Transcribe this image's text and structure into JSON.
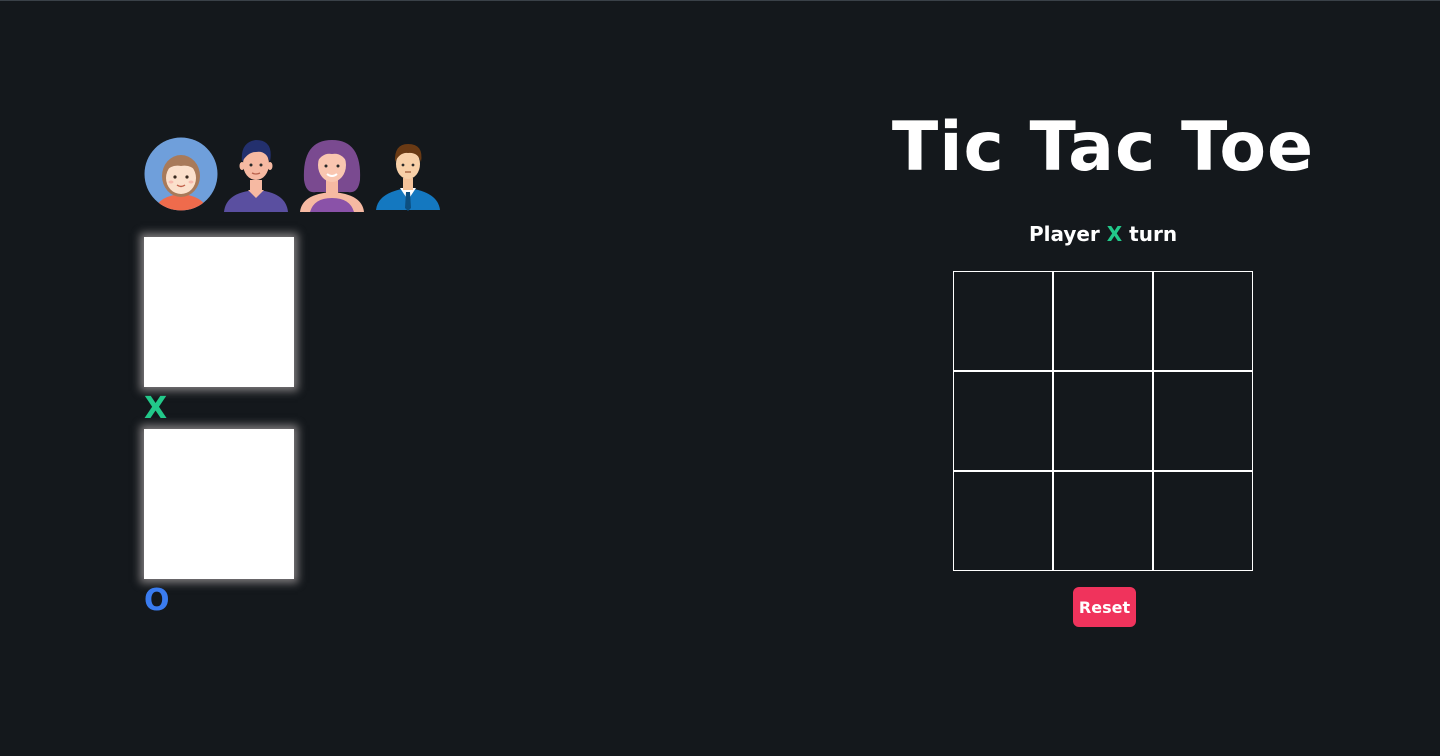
{
  "game": {
    "title": "Tic Tac Toe",
    "turn": {
      "prefix": "Player",
      "player": "X",
      "suffix": "turn"
    },
    "board": [
      "",
      "",
      "",
      "",
      "",
      "",
      "",
      "",
      ""
    ],
    "reset_label": "Reset"
  },
  "players": {
    "x_mark": "X",
    "o_mark": "O"
  },
  "avatars": [
    {
      "name": "avatar-girl-icon"
    },
    {
      "name": "avatar-man-icon"
    },
    {
      "name": "avatar-woman-icon"
    },
    {
      "name": "avatar-businessman-icon"
    }
  ],
  "colors": {
    "background": "#14181c",
    "x_color": "#22c98a",
    "o_color": "#3a7cf0",
    "reset_button": "#f0335c"
  }
}
